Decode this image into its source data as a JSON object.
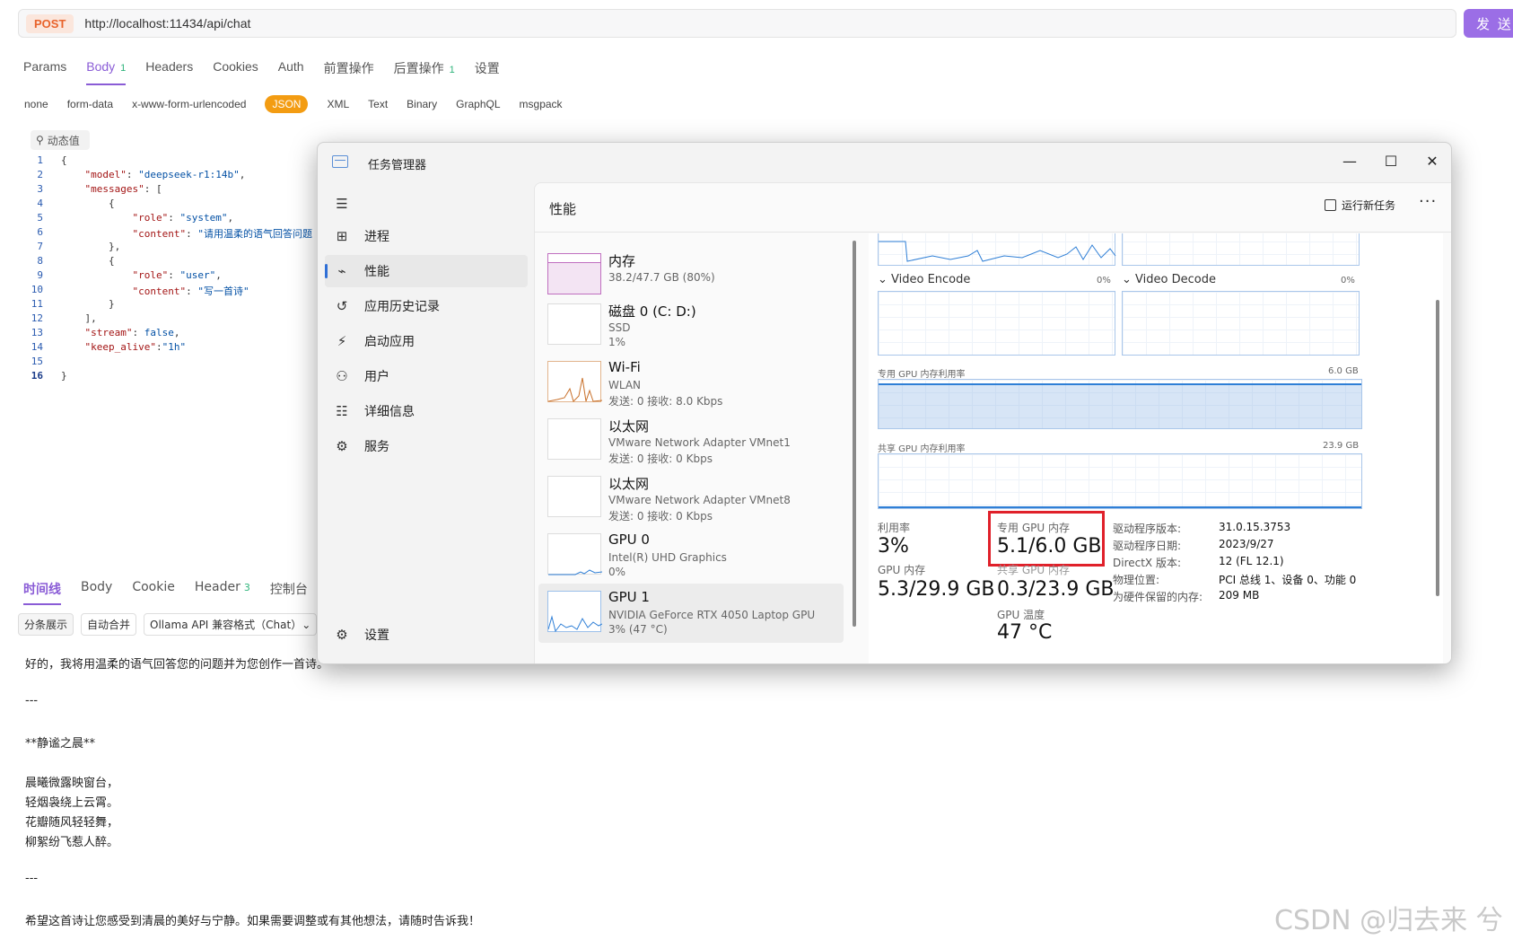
{
  "request": {
    "method": "POST",
    "url": "http://localhost:11434/api/chat",
    "send_label": "发 送"
  },
  "request_tabs": [
    {
      "label": "Params",
      "count": ""
    },
    {
      "label": "Body",
      "count": "1"
    },
    {
      "label": "Headers",
      "count": ""
    },
    {
      "label": "Cookies",
      "count": ""
    },
    {
      "label": "Auth",
      "count": ""
    },
    {
      "label": "前置操作",
      "count": ""
    },
    {
      "label": "后置操作",
      "count": "1"
    },
    {
      "label": "设置",
      "count": ""
    }
  ],
  "body_types": [
    "none",
    "form-data",
    "x-www-form-urlencoded",
    "JSON",
    "XML",
    "Text",
    "Binary",
    "GraphQL",
    "msgpack"
  ],
  "dynamic_value_label": "动态值",
  "code_lines": [
    {
      "n": "1",
      "text": "{"
    },
    {
      "n": "2",
      "text": "    \"model\": \"deepseek-r1:14b\","
    },
    {
      "n": "3",
      "text": "    \"messages\": ["
    },
    {
      "n": "4",
      "text": "        {"
    },
    {
      "n": "5",
      "text": "            \"role\": \"system\","
    },
    {
      "n": "6",
      "text": "            \"content\": \"请用温柔的语气回答问题"
    },
    {
      "n": "7",
      "text": "        },"
    },
    {
      "n": "8",
      "text": "        {"
    },
    {
      "n": "9",
      "text": "            \"role\": \"user\","
    },
    {
      "n": "10",
      "text": "            \"content\": \"写一首诗\""
    },
    {
      "n": "11",
      "text": "        }"
    },
    {
      "n": "12",
      "text": "    ],"
    },
    {
      "n": "13",
      "text": "    \"stream\": false,"
    },
    {
      "n": "14",
      "text": "    \"keep_alive\":\"1h\""
    },
    {
      "n": "15",
      "text": ""
    },
    {
      "n": "16",
      "text": "}"
    }
  ],
  "response_tabs": [
    {
      "label": "时间线",
      "count": ""
    },
    {
      "label": "Body",
      "count": ""
    },
    {
      "label": "Cookie",
      "count": ""
    },
    {
      "label": "Header",
      "count": "3"
    },
    {
      "label": "控制台",
      "count": ""
    }
  ],
  "response_tools": [
    "分条展示",
    "自动合并",
    "Ollama API 兼容格式（Chat）⌄"
  ],
  "response_lines": [
    "好的，我将用温柔的语气回答您的问题并为您创作一首诗。",
    "---",
    "**静谧之晨**",
    "晨曦微露映窗台，",
    "轻烟袅绕上云霄。",
    "花瓣随风轻轻舞，",
    "柳絮纷飞惹人醉。",
    "---",
    "希望这首诗让您感受到清晨的美好与宁静。如果需要调整或有其他想法，请随时告诉我！"
  ],
  "watermark": "CSDN @归去来 兮",
  "task_manager": {
    "title": "任务管理器",
    "window_buttons": {
      "minimize": "—",
      "maximize": "☐",
      "close": "✕"
    },
    "nav": [
      {
        "label": "",
        "icon": "hamburger-icon"
      },
      {
        "label": "进程",
        "icon": "processes-icon"
      },
      {
        "label": "性能",
        "icon": "performance-icon"
      },
      {
        "label": "应用历史记录",
        "icon": "app-history-icon"
      },
      {
        "label": "启动应用",
        "icon": "startup-icon"
      },
      {
        "label": "用户",
        "icon": "users-icon"
      },
      {
        "label": "详细信息",
        "icon": "details-icon"
      },
      {
        "label": "服务",
        "icon": "services-icon"
      }
    ],
    "settings_label": "设置",
    "section_title": "性能",
    "run_new_task": "运行新任务",
    "more": "···",
    "devices": [
      {
        "name": "内存",
        "sub1": "38.2/47.7 GB (80%)",
        "sub2": "",
        "color": "#c06fc0"
      },
      {
        "name": "磁盘 0 (C: D:)",
        "sub1": "SSD",
        "sub2": "1%",
        "color": "#4caf50"
      },
      {
        "name": "Wi-Fi",
        "sub1": "WLAN",
        "sub2": "发送: 0 接收: 8.0 Kbps",
        "color": "#c8702a"
      },
      {
        "name": "以太网",
        "sub1": "VMware Network Adapter VMnet1",
        "sub2": "发送: 0 接收: 0 Kbps",
        "color": "#c8702a"
      },
      {
        "name": "以太网",
        "sub1": "VMware Network Adapter VMnet8",
        "sub2": "发送: 0 接收: 0 Kbps",
        "color": "#c8702a"
      },
      {
        "name": "GPU 0",
        "sub1": "Intel(R) UHD Graphics",
        "sub2": "0%",
        "color": "#2f7fd6"
      },
      {
        "name": "GPU 1",
        "sub1": "NVIDIA GeForce RTX 4050 Laptop GPU",
        "sub2": "3% (47 °C)",
        "color": "#2f7fd6"
      }
    ],
    "gpu_detail": {
      "video_encode": "Video Encode",
      "video_encode_pct": "0%",
      "video_decode": "Video Decode",
      "video_decode_pct": "0%",
      "dedicated_graph_label": "专用 GPU 内存利用率",
      "dedicated_graph_max": "6.0 GB",
      "shared_graph_label": "共享 GPU 内存利用率",
      "shared_graph_max": "23.9 GB",
      "stats": {
        "utilization_label": "利用率",
        "utilization": "3%",
        "dedicated_label": "专用 GPU 内存",
        "dedicated": "5.1/6.0 GB",
        "gpu_mem_label": "GPU 内存",
        "gpu_mem": "5.3/29.9 GB",
        "shared_label": "共享 GPU 内存",
        "shared": "0.3/23.9 GB",
        "temp_label": "GPU 温度",
        "temp": "47 °C"
      },
      "info": [
        {
          "k": "驱动程序版本:",
          "v": "31.0.15.3753"
        },
        {
          "k": "驱动程序日期:",
          "v": "2023/9/27"
        },
        {
          "k": "DirectX 版本:",
          "v": "12 (FL 12.1)"
        },
        {
          "k": "物理位置:",
          "v": "PCI 总线 1、设备 0、功能 0"
        },
        {
          "k": "为硬件保留的内存:",
          "v": "209 MB"
        }
      ]
    }
  }
}
